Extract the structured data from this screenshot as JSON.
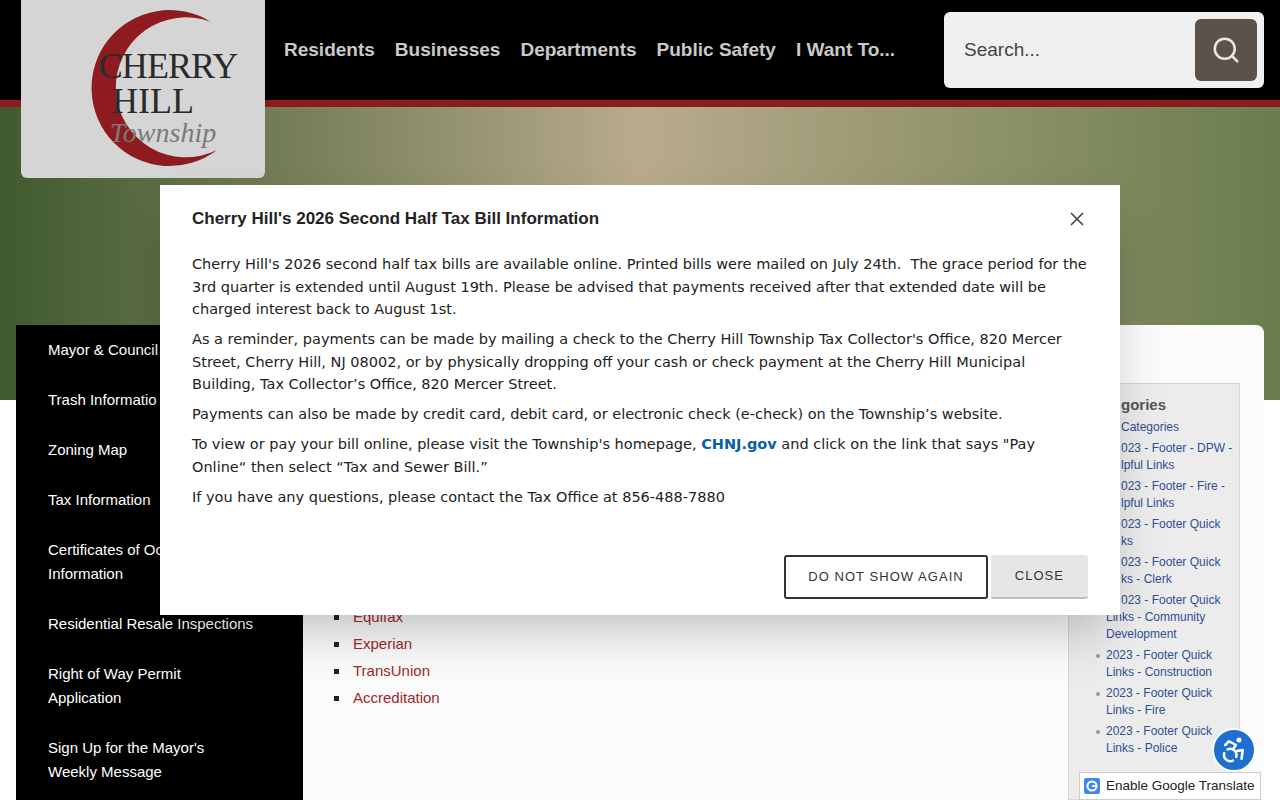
{
  "logo": {
    "line1": "CHERRY",
    "line2": "HILL",
    "line3": "Township"
  },
  "nav": [
    "Residents",
    "Businesses",
    "Departments",
    "Public Safety",
    "I Want To..."
  ],
  "search": {
    "placeholder": "Search..."
  },
  "sidebar": {
    "items": [
      {
        "lines": [
          "Mayor & Council"
        ]
      },
      {
        "lines": [
          "Trash Informatio"
        ]
      },
      {
        "lines": [
          "Zoning Map"
        ]
      },
      {
        "lines": [
          "Tax Information"
        ]
      },
      {
        "lines": [
          "Certificates of Oc",
          "Information"
        ]
      },
      {
        "lines": [
          "Residential Resale Inspections"
        ]
      },
      {
        "lines": [
          "Right of Way Permit",
          "Application"
        ]
      },
      {
        "lines": [
          "Sign Up for the Mayor's",
          "Weekly Message"
        ]
      }
    ]
  },
  "content": {
    "links": [
      "Equifax",
      "Experian",
      "TransUnion",
      "Accreditation"
    ]
  },
  "categories": {
    "heading": "gories",
    "items": [
      {
        "lines": [
          {
            "text": "Categories",
            "clipped": true
          }
        ]
      },
      {
        "lines": [
          {
            "text": "023 - Footer - DPW -",
            "clipped": true
          },
          {
            "text": "lpful Links",
            "clipped": true
          }
        ]
      },
      {
        "lines": [
          {
            "text": "023 - Footer - Fire -",
            "clipped": true
          },
          {
            "text": "lpful Links",
            "clipped": true
          }
        ]
      },
      {
        "lines": [
          {
            "text": "023 - Footer Quick",
            "clipped": true
          },
          {
            "text": "ks",
            "clipped": true
          }
        ]
      },
      {
        "lines": [
          {
            "text": "023 - Footer Quick",
            "clipped": true
          },
          {
            "text": "ks - Clerk",
            "clipped": true
          }
        ]
      },
      {
        "lines": [
          {
            "text": "023 - Footer Quick",
            "clipped": true
          },
          {
            "text": "Links - Community",
            "clipped": false
          },
          {
            "text": "Development",
            "clipped": false
          }
        ]
      },
      {
        "lines": [
          {
            "text": "2023 - Footer Quick",
            "clipped": false
          },
          {
            "text": "Links - Construction",
            "clipped": false
          }
        ]
      },
      {
        "lines": [
          {
            "text": "2023 - Footer Quick",
            "clipped": false
          },
          {
            "text": "Links - Fire",
            "clipped": false
          }
        ]
      },
      {
        "lines": [
          {
            "text": "2023 - Footer Quick",
            "clipped": false
          },
          {
            "text": "Links - Police",
            "clipped": false
          }
        ]
      }
    ]
  },
  "modal": {
    "title": "Cherry Hill's 2026 Second Half Tax Bill Information",
    "paragraphs": [
      [
        {
          "text": "Cherry Hill's 2026 second half tax bills are available online. Printed bills were mailed on July 24th.  The grace period for the 3rd quarter is extended until August 19th. Please be advised that payments received after that extended date will be charged interest back to August 1st.",
          "link": false
        }
      ],
      [
        {
          "text": "As a reminder, payments can be made by mailing a check to the Cherry Hill Township Tax Collector's Office, 820 Mercer Street, Cherry Hill, NJ 08002, or by physically dropping off your cash or check payment at the Cherry Hill Municipal Building, Tax Collector’s Office, 820 Mercer Street.",
          "link": false
        }
      ],
      [
        {
          "text": "Payments can also be made by credit card, debit card, or electronic check (e-check) on the Township’s website.",
          "link": false
        }
      ],
      [
        {
          "text": "To view or pay your bill online, please visit the Township's homepage, ",
          "link": false
        },
        {
          "text": "CHNJ.gov",
          "link": true
        },
        {
          "text": " and click on the link that says \"Pay Online“ then select “Tax and Sewer Bill.”",
          "link": false
        }
      ],
      [
        {
          "text": "If you have any questions, please contact the Tax Office at 856-488-7880",
          "link": false
        }
      ]
    ],
    "buttons": [
      {
        "label": "DO NOT SHOW AGAIN",
        "kind": "outlined"
      },
      {
        "label": "CLOSE",
        "kind": "filled"
      }
    ]
  },
  "translate": {
    "label": "Enable Google Translate"
  }
}
